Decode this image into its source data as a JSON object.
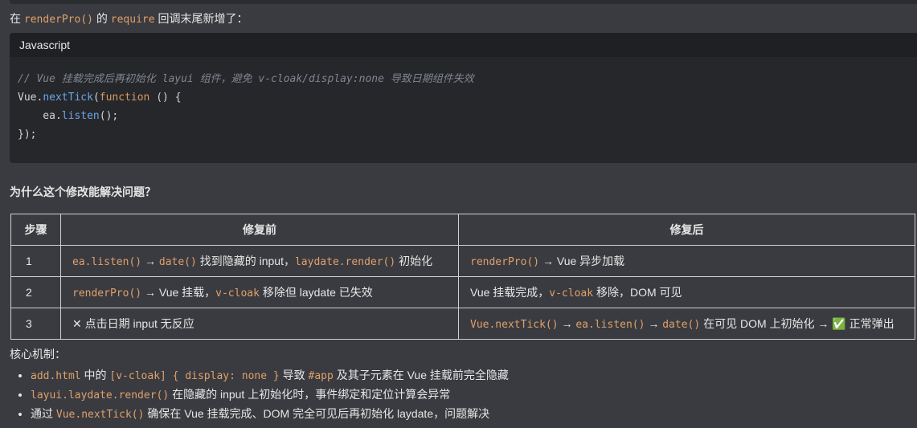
{
  "intro": {
    "prefix": "在 ",
    "code1": "renderPro()",
    "mid": " 的 ",
    "code2": "require",
    "suffix": " 回调末尾新增了："
  },
  "codeblock": {
    "language": "Javascript",
    "comment": "// Vue 挂载完成后再初始化 layui 组件，避免 v-cloak/display:none 导致日期组件失效",
    "l2a": "Vue.",
    "l2b": "nextTick",
    "l2c": "(",
    "l2d": "function",
    "l2e": " () {",
    "l3a": "    ea.",
    "l3b": "listen",
    "l3c": "();",
    "l4": "});"
  },
  "question": "为什么这个修改能解决问题？",
  "table": {
    "headers": [
      "步骤",
      "修复前",
      "修复后"
    ],
    "r1": {
      "step": "1",
      "b1": "ea.listen()",
      "b2": " → ",
      "b3": "date()",
      "b4": " 找到隐藏的 input，",
      "b5": "laydate.render()",
      "b6": " 初始化",
      "a1": "renderPro()",
      "a2": " → Vue 异步加载"
    },
    "r2": {
      "step": "2",
      "b1": "renderPro()",
      "b2": " → Vue 挂载，",
      "b3": "v-cloak",
      "b4": " 移除但 laydate 已失效",
      "a1": "Vue 挂载完成，",
      "a2": "v-cloak",
      "a3": " 移除，DOM 可见"
    },
    "r3": {
      "step": "3",
      "b1": "✕ 点击日期 input 无反应",
      "a1": "Vue.nextTick()",
      "a2": " → ",
      "a3": "ea.listen()",
      "a4": " → ",
      "a5": "date()",
      "a6": " 在可见 DOM 上初始化 → ✅ 正常弹出"
    }
  },
  "core": {
    "title": "核心机制：",
    "i1": {
      "c1": "add.html",
      "t1": " 中的 ",
      "c2": "[v-cloak] { display: none }",
      "t2": " 导致 ",
      "c3": "#app",
      "t3": " 及其子元素在 Vue 挂载前完全隐藏"
    },
    "i2": {
      "c1": "layui.laydate.render()",
      "t1": " 在隐藏的 input 上初始化时，事件绑定和定位计算会异常"
    },
    "i3": {
      "t0": "通过 ",
      "c1": "Vue.nextTick()",
      "t1": " 确保在 Vue 挂载完成、DOM 完全可见后再初始化 laydate，问题解决"
    }
  }
}
